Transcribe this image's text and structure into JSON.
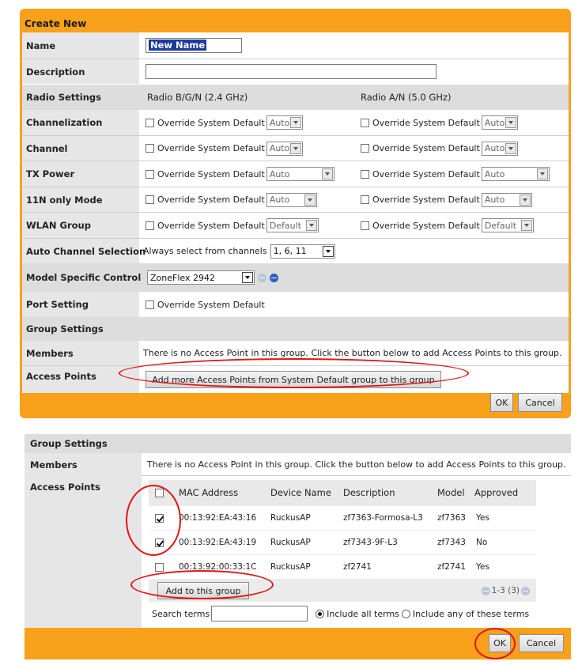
{
  "create_panel": {
    "title": "Create New",
    "name_label": "Name",
    "name_value": "New Name",
    "description_label": "Description",
    "description_value": "",
    "radio_settings_label": "Radio Settings",
    "radio_bg_label": "Radio B/G/N (2.4 GHz)",
    "radio_an_label": "Radio A/N (5.0 GHz)",
    "override_label": "Override System Default",
    "rows": [
      {
        "label": "Channelization",
        "left": "Auto",
        "right": "Auto"
      },
      {
        "label": "Channel",
        "left": "Auto",
        "right": "Auto"
      },
      {
        "label": "TX Power",
        "left": "Auto",
        "right": "Auto"
      },
      {
        "label": "11N only Mode",
        "left": "Auto",
        "right": "Auto"
      },
      {
        "label": "WLAN Group",
        "left": "Default",
        "right": "Default"
      }
    ],
    "auto_channel": {
      "label": "Auto Channel Selection",
      "text": "Always select from channels",
      "value": "1, 6, 11"
    },
    "model_control": {
      "label": "Model Specific Control",
      "value": "ZoneFlex 2942"
    },
    "port_setting": {
      "label": "Port Setting",
      "checkbox_label": "Override System Default"
    },
    "group_settings_label": "Group Settings",
    "members_label": "Members",
    "members_text": "There is no Access Point in this group. Click the button below to add Access Points to this group.",
    "access_points_label": "Access Points",
    "add_more_button": "Add more Access Points from System Default group to this group",
    "ok_button": "OK",
    "cancel_button": "Cancel"
  },
  "group_panel": {
    "title": "Group Settings",
    "members_label": "Members",
    "members_text": "There is no Access Point in this group. Click the button below to add Access Points to this group.",
    "access_points_label": "Access Points",
    "table": {
      "headers": [
        "MAC Address",
        "Device Name",
        "Description",
        "Model",
        "Approved"
      ],
      "rows": [
        {
          "checked": true,
          "mac": "00:13:92:EA:43:16",
          "device": "RuckusAP",
          "description": "zf7363-Formosa-L3",
          "model": "zf7363",
          "approved": "Yes"
        },
        {
          "checked": true,
          "mac": "00:13:92:EA:43:19",
          "device": "RuckusAP",
          "description": "zf7343-9F-L3",
          "model": "zf7343",
          "approved": "No"
        },
        {
          "checked": false,
          "mac": "00:13:92:00:33:1C",
          "device": "RuckusAP",
          "description": "zf2741",
          "model": "zf2741",
          "approved": "Yes"
        }
      ]
    },
    "add_button": "Add to this group",
    "pager_text": "1-3 (3)",
    "search_label": "Search terms",
    "search_value": "",
    "radio_all": "Include all terms",
    "radio_any": "Include any of these terms",
    "ok_button": "OK",
    "cancel_button": "Cancel"
  },
  "colors": {
    "accent": "#F9A11B",
    "highlight": "#E01515",
    "label_bg": "#E6E6E6",
    "section_bg": "#DDDDDD"
  }
}
